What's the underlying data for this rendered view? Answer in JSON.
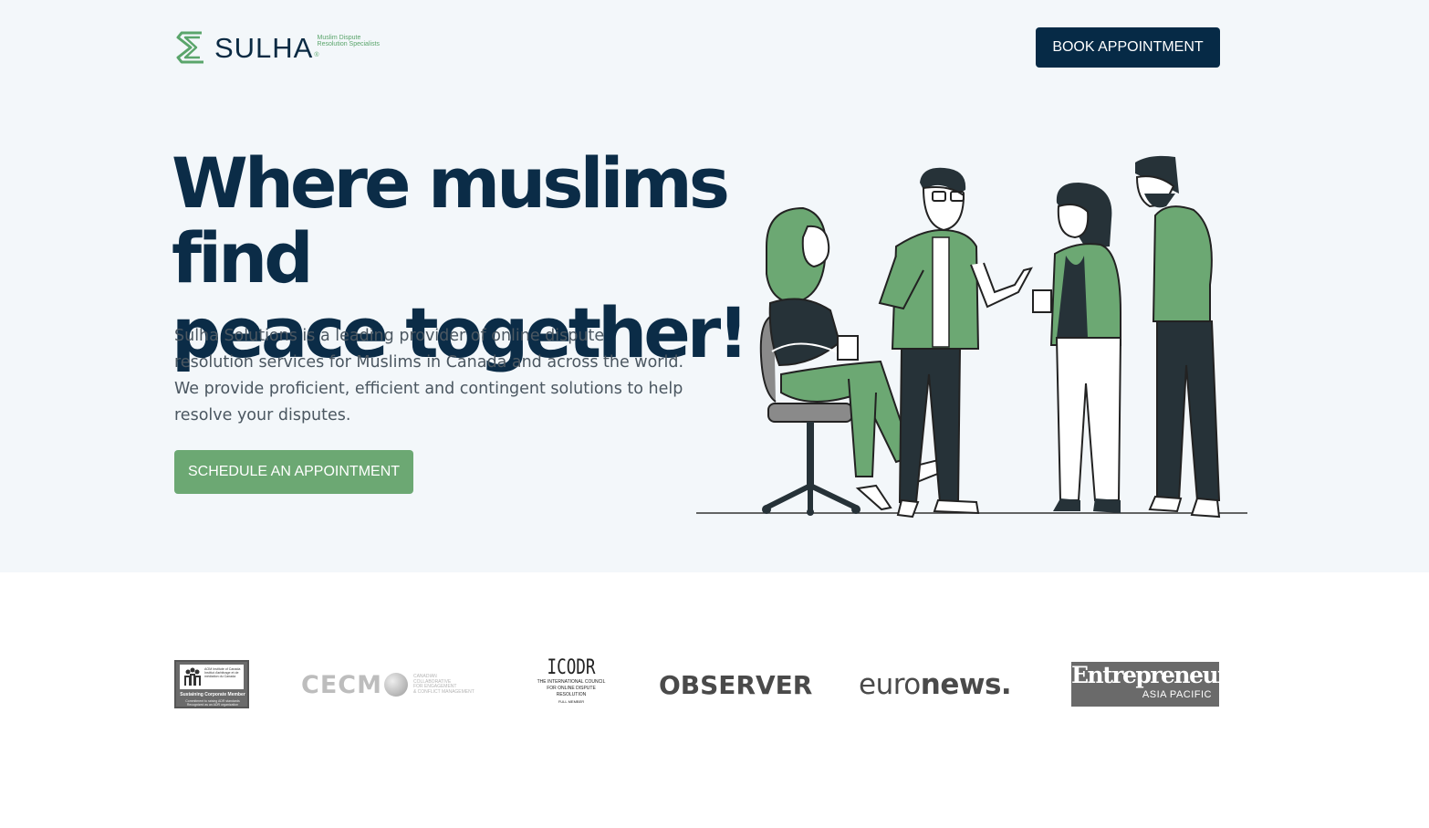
{
  "header": {
    "logo_word": "SULHA",
    "logo_reg": "®",
    "logo_tagline_1": "Muslim Dispute",
    "logo_tagline_2": "Resolution Specialists",
    "book_label": "BOOK APPOINTMENT"
  },
  "hero": {
    "headline_line1": "Where muslims find",
    "headline_line2": "peace together!",
    "description": "Sulha Solutions is a leading provider of online dispute resolution services for Muslims in Canada and across the world. We provide proficient, efficient and contingent solutions to help resolve your disputes.",
    "cta_label": "SCHEDULE AN APPOINTMENT"
  },
  "partners": {
    "aom": {
      "line1": "AOM Institute of Canada",
      "line2": "Institut d'arbitrage et de",
      "line3": "médiation du Canada",
      "member": "Sustaining Corporate Member",
      "note": "Commitment to raising ADR standards",
      "note2": "Recognized as an ADR organization"
    },
    "cecm": {
      "word": "CECM",
      "tag1": "CANADIAN",
      "tag2": "COLLABORATIVE",
      "tag3": "FOR ENGAGEMENT",
      "tag4": "& CONFLICT MANAGEMENT"
    },
    "icodr": {
      "word": "ICODR",
      "sub1": "THE INTERNATIONAL COUNCIL",
      "sub2": "FOR ONLINE DISPUTE RESOLUTION",
      "sub3": "FULL MEMBER"
    },
    "observer": "OBSERVER",
    "euronews_a": "euro",
    "euronews_b": "news.",
    "entrepreneur": "Entrepreneur",
    "entrepreneur_sub": "ASIA PACIFIC"
  },
  "colors": {
    "navy": "#062a46",
    "green": "#6ca873",
    "hero_bg": "#f3f7fa"
  }
}
